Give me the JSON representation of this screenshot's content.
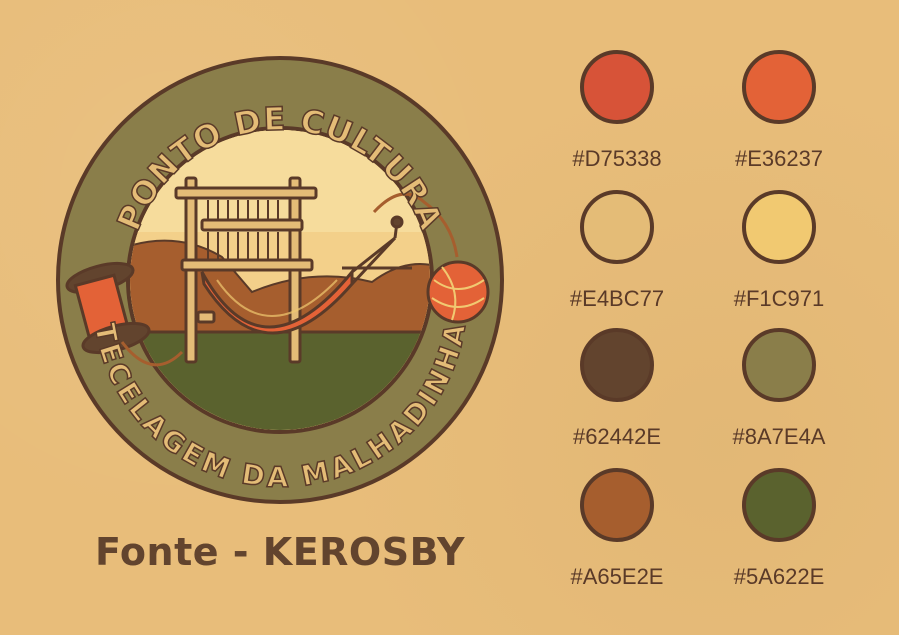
{
  "emblem": {
    "top_text": "PONTO DE CULTURA",
    "bottom_text": "TECELAGEM DA MALHADINHA",
    "icons": [
      "loom-icon",
      "hammock-icon",
      "thread-spool-icon",
      "yarn-ball-icon",
      "hills-icon"
    ]
  },
  "font_caption": "Fonte - KEROSBY",
  "palette": [
    {
      "hex": "#D75338",
      "color": "#D75338"
    },
    {
      "hex": "#E36237",
      "color": "#E36237"
    },
    {
      "hex": "#E4BC77",
      "color": "#E4BC77"
    },
    {
      "hex": "#F1C971",
      "color": "#F1C971"
    },
    {
      "hex": "#62442E",
      "color": "#62442E"
    },
    {
      "hex": "#8A7E4A",
      "color": "#8A7E4A"
    },
    {
      "hex": "#A65E2E",
      "color": "#A65E2E"
    },
    {
      "hex": "#5A622E",
      "color": "#5A622E"
    }
  ]
}
